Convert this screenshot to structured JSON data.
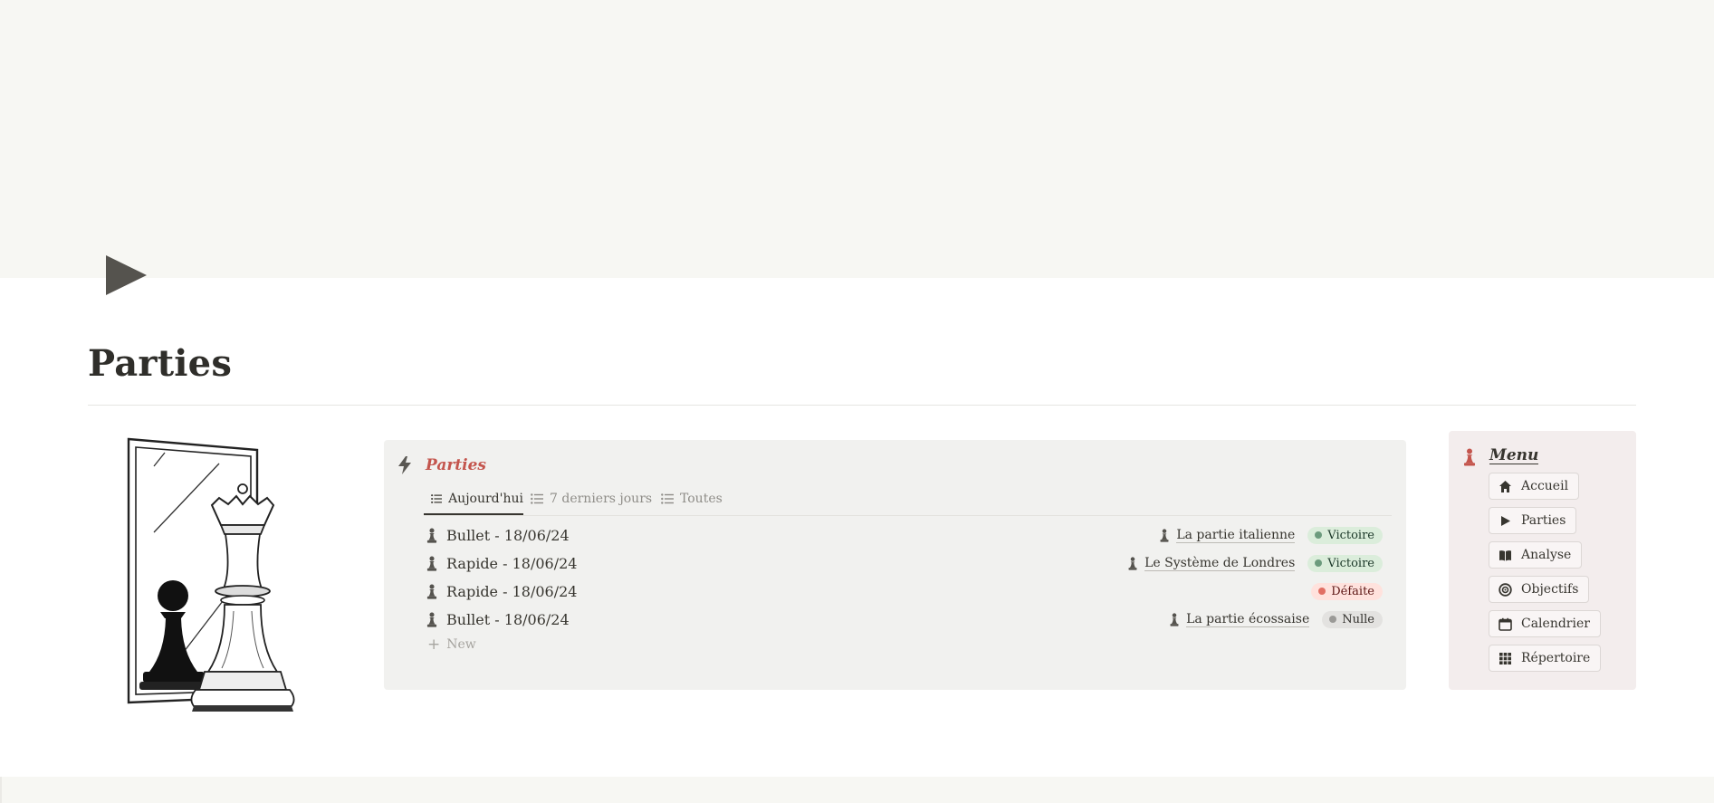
{
  "page": {
    "title": "Parties"
  },
  "database": {
    "title": "Parties",
    "tabs": [
      {
        "label": "Aujourd'hui",
        "active": true
      },
      {
        "label": "7 derniers jours",
        "active": false
      },
      {
        "label": "Toutes",
        "active": false
      }
    ],
    "rows": [
      {
        "name": "Bullet - 18/06/24",
        "opening": "La partie italienne",
        "result": "Victoire",
        "result_color": "#448361"
      },
      {
        "name": "Rapide - 18/06/24",
        "opening": "Le Système de Londres",
        "result": "Victoire",
        "result_color": "#448361"
      },
      {
        "name": "Rapide - 18/06/24",
        "opening": "",
        "result": "Défaite",
        "result_color": "#d44c47"
      },
      {
        "name": "Bullet - 18/06/24",
        "opening": "La partie écossaise",
        "result": "Nulle",
        "result_color": "#9b9a97"
      }
    ],
    "new_label": "New"
  },
  "menu": {
    "title": "Menu",
    "items": [
      {
        "label": "Accueil",
        "icon": "home-icon"
      },
      {
        "label": "Parties",
        "icon": "play-icon"
      },
      {
        "label": "Analyse",
        "icon": "book-icon"
      },
      {
        "label": "Objectifs",
        "icon": "target-icon"
      },
      {
        "label": "Calendrier",
        "icon": "calendar-icon"
      },
      {
        "label": "Répertoire",
        "icon": "grid-icon"
      }
    ]
  },
  "colors": {
    "accent_red": "#c4554d",
    "victory_bg": "#dbeddb",
    "defeat_bg": "#ffe2dd",
    "draw_bg": "#e3e2e0",
    "cover": "#f7f7f3",
    "menu_bg": "#f3eded"
  }
}
